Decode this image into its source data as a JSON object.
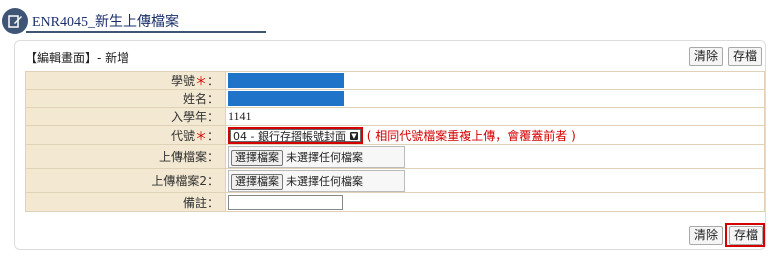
{
  "header": {
    "title": "ENR4045_新生上傳檔案",
    "icon": "edit-icon"
  },
  "panel": {
    "title": "【編輯畫面】- 新增",
    "clear_label": "清除",
    "save_label": "存檔"
  },
  "form": {
    "student_id": {
      "label": "學號",
      "required_mark": "＊",
      "colon": "：",
      "value_masked": true
    },
    "name": {
      "label": "姓名",
      "colon": "：",
      "value_masked": true
    },
    "enroll_year": {
      "label": "入學年",
      "colon": "：",
      "value": "1141"
    },
    "code": {
      "label": "代號",
      "required_mark": "＊",
      "colon": "：",
      "selected": "04 - 銀行存摺帳號封面",
      "note": "( 相同代號檔案重複上傳，會覆蓋前者 )"
    },
    "upload1": {
      "label": "上傳檔案",
      "colon": "：",
      "button": "選擇檔案",
      "status": "未選擇任何檔案"
    },
    "upload2": {
      "label": "上傳檔案2",
      "colon": "：",
      "button": "選擇檔案",
      "status": "未選擇任何檔案"
    },
    "remark": {
      "label": "備註",
      "colon": "：",
      "value": ""
    }
  },
  "colors": {
    "label_bg": "#f3e8d2",
    "highlight": "#d40000",
    "masked_value": "#1f73c9",
    "header_accent": "#3e5576"
  }
}
